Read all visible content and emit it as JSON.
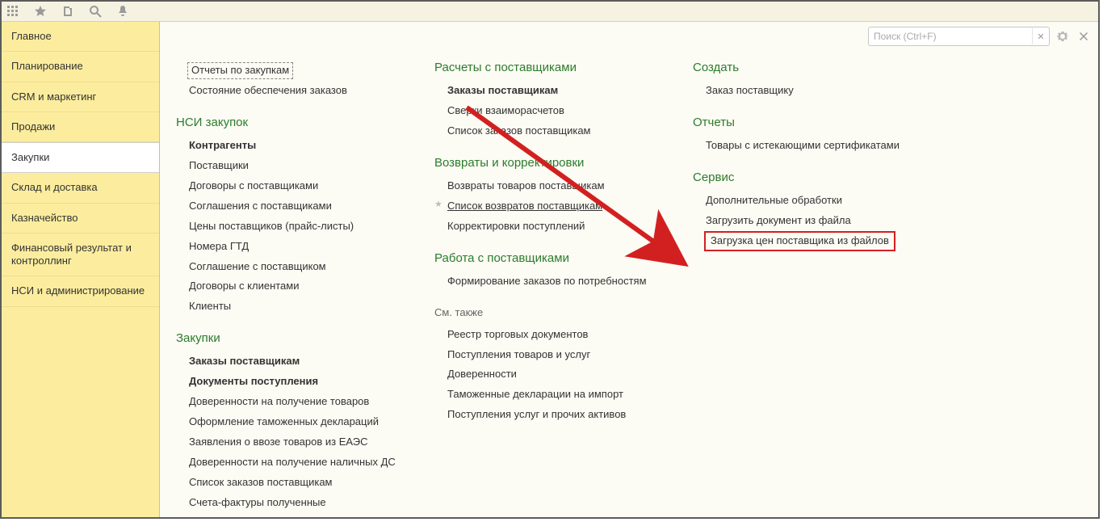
{
  "search": {
    "placeholder": "Поиск (Ctrl+F)"
  },
  "sidebar": {
    "items": [
      {
        "label": "Главное"
      },
      {
        "label": "Планирование"
      },
      {
        "label": "CRM и маркетинг"
      },
      {
        "label": "Продажи"
      },
      {
        "label": "Закупки"
      },
      {
        "label": "Склад и доставка"
      },
      {
        "label": "Казначейство"
      },
      {
        "label": "Финансовый результат и контроллинг"
      },
      {
        "label": "НСИ и администрирование"
      }
    ],
    "active_index": 4
  },
  "col1": {
    "top": [
      {
        "label": "Отчеты по закупкам",
        "style": "dashed"
      },
      {
        "label": "Состояние обеспечения заказов"
      }
    ],
    "g1_title": "НСИ закупок",
    "g1": [
      {
        "label": "Контрагенты",
        "style": "bold"
      },
      {
        "label": "Поставщики"
      },
      {
        "label": "Договоры с поставщиками"
      },
      {
        "label": "Соглашения с поставщиками"
      },
      {
        "label": "Цены поставщиков (прайс-листы)"
      },
      {
        "label": "Номера ГТД"
      },
      {
        "label": "Соглашение с поставщиком"
      },
      {
        "label": "Договоры с клиентами"
      },
      {
        "label": "Клиенты"
      }
    ],
    "g2_title": "Закупки",
    "g2": [
      {
        "label": "Заказы поставщикам",
        "style": "bold"
      },
      {
        "label": "Документы поступления",
        "style": "bold"
      },
      {
        "label": "Доверенности на получение товаров"
      },
      {
        "label": "Оформление таможенных деклараций"
      },
      {
        "label": "Заявления о ввозе товаров из ЕАЭС"
      },
      {
        "label": "Доверенности на получение наличных ДС"
      },
      {
        "label": "Список заказов поставщикам"
      },
      {
        "label": "Счета-фактуры полученные"
      }
    ]
  },
  "col2": {
    "g1_title": "Расчеты с поставщиками",
    "g1": [
      {
        "label": "Заказы поставщикам",
        "style": "bold"
      },
      {
        "label": "Сверки взаиморасчетов"
      },
      {
        "label": "Список заказов поставщикам"
      }
    ],
    "g2_title": "Возвраты и корректировки",
    "g2": [
      {
        "label": "Возвраты товаров поставщикам"
      },
      {
        "label": "Список возвратов поставщикам",
        "style": "starred"
      },
      {
        "label": "Корректировки поступлений"
      }
    ],
    "g3_title": "Работа с поставщиками",
    "g3": [
      {
        "label": "Формирование заказов по потребностям"
      }
    ],
    "seealso_title": "См. также",
    "seealso": [
      {
        "label": "Реестр торговых документов"
      },
      {
        "label": "Поступления товаров и услуг"
      },
      {
        "label": "Доверенности"
      },
      {
        "label": "Таможенные декларации на импорт"
      },
      {
        "label": "Поступления услуг и прочих активов"
      }
    ]
  },
  "col3": {
    "g1_title": "Создать",
    "g1": [
      {
        "label": "Заказ поставщику"
      }
    ],
    "g2_title": "Отчеты",
    "g2": [
      {
        "label": "Товары с истекающими сертификатами"
      }
    ],
    "g3_title": "Сервис",
    "g3": [
      {
        "label": "Дополнительные обработки"
      },
      {
        "label": "Загрузить документ из файла"
      },
      {
        "label": "Загрузка цен поставщика из файлов",
        "style": "highlighted"
      }
    ]
  }
}
